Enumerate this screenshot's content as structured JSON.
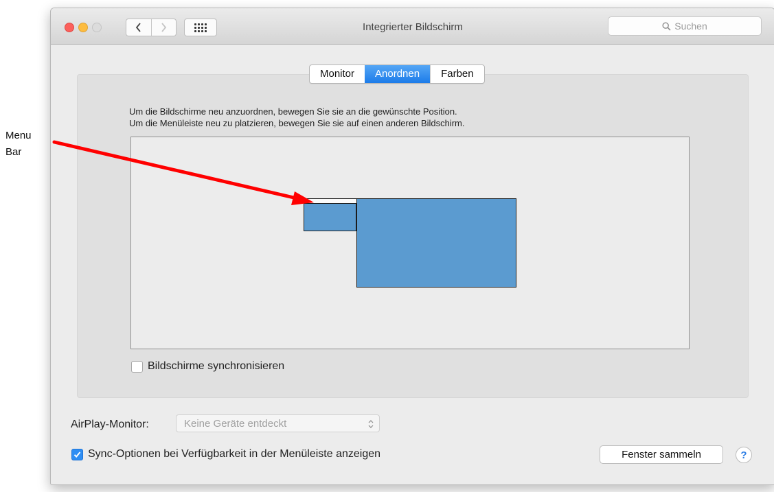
{
  "annotation": {
    "line1": "Menu",
    "line2": "Bar"
  },
  "window": {
    "title": "Integrierter Bildschirm"
  },
  "toolbar": {
    "back_icon": "chevron-left-icon",
    "forward_icon": "chevron-right-icon",
    "grid_icon": "grid-icon"
  },
  "search": {
    "placeholder": "Suchen",
    "icon": "search-icon"
  },
  "tabs": [
    {
      "label": "Monitor",
      "active": false
    },
    {
      "label": "Anordnen",
      "active": true
    },
    {
      "label": "Farben",
      "active": false
    }
  ],
  "arrange": {
    "instruction_1": "Um die Bildschirme neu anzuordnen, bewegen Sie sie an die gewünschte Position.",
    "instruction_2": "Um die Menüleiste neu zu platzieren, bewegen Sie sie auf einen anderen Bildschirm.",
    "mirror_label": "Bildschirme synchronisieren",
    "mirror_checked": false
  },
  "airplay": {
    "label": "AirPlay-Monitor:",
    "value": "Keine Geräte entdeckt"
  },
  "sync_options": {
    "label": "Sync-Optionen bei Verfügbarkeit in der Menüleiste anzeigen",
    "checked": true
  },
  "buttons": {
    "gather": "Fenster sammeln",
    "help": "?"
  },
  "colors": {
    "display_fill": "#5b9bd0",
    "accent": "#2f8ef3",
    "arrow": "#ff0000"
  }
}
